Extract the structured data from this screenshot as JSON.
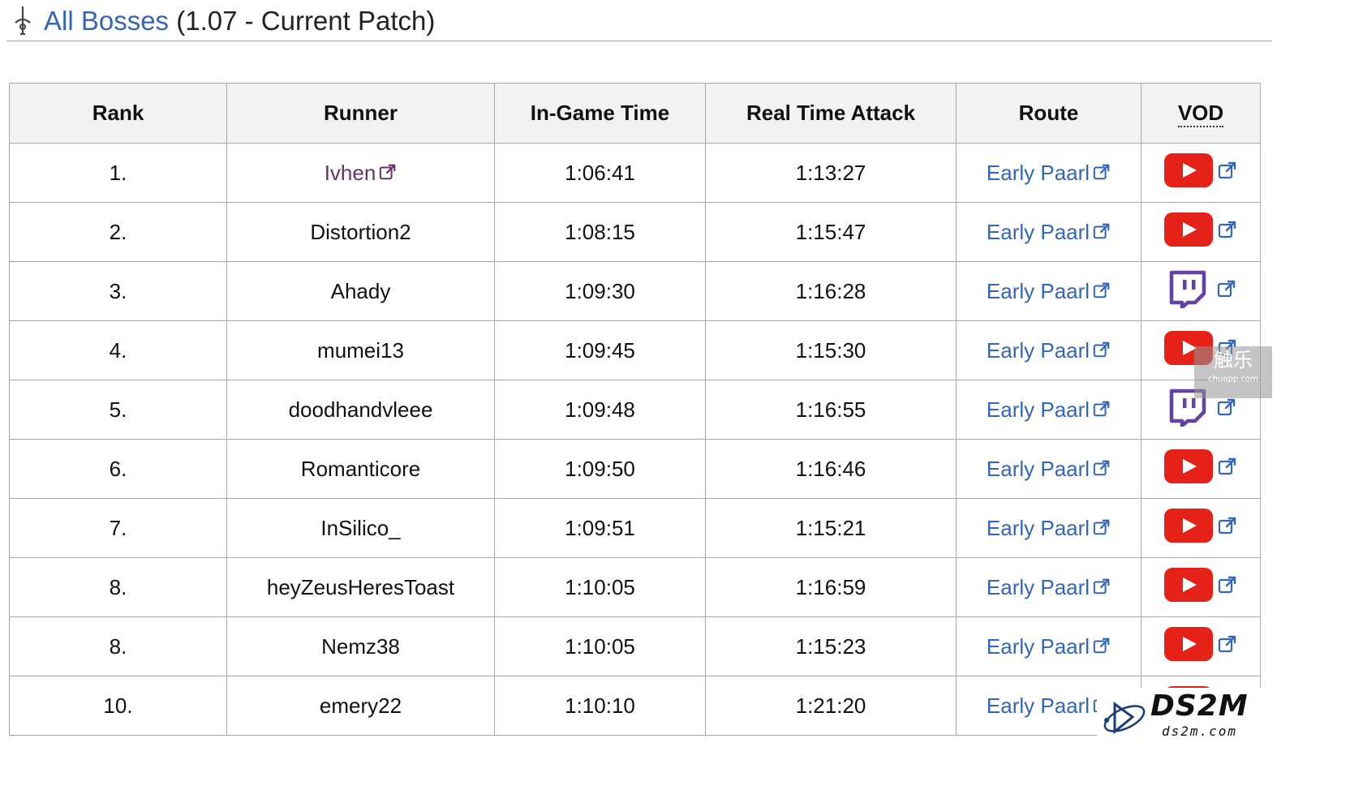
{
  "header": {
    "title_link": "All Bosses",
    "title_rest": " (1.07 - Current Patch)",
    "icon": "sword-icon"
  },
  "table": {
    "columns": [
      "Rank",
      "Runner",
      "In-Game Time",
      "Real Time Attack",
      "Route",
      "VOD"
    ],
    "rows": [
      {
        "rank": "1.",
        "runner": "Ivhen",
        "runner_link": true,
        "igt": "1:06:41",
        "rta": "1:13:27",
        "route": "Early Paarl",
        "vod": "youtube"
      },
      {
        "rank": "2.",
        "runner": "Distortion2",
        "runner_link": false,
        "igt": "1:08:15",
        "rta": "1:15:47",
        "route": "Early Paarl",
        "vod": "youtube"
      },
      {
        "rank": "3.",
        "runner": "Ahady",
        "runner_link": false,
        "igt": "1:09:30",
        "rta": "1:16:28",
        "route": "Early Paarl",
        "vod": "twitch"
      },
      {
        "rank": "4.",
        "runner": "mumei13",
        "runner_link": false,
        "igt": "1:09:45",
        "rta": "1:15:30",
        "route": "Early Paarl",
        "vod": "youtube"
      },
      {
        "rank": "5.",
        "runner": "doodhandvleee",
        "runner_link": false,
        "igt": "1:09:48",
        "rta": "1:16:55",
        "route": "Early Paarl",
        "vod": "twitch"
      },
      {
        "rank": "6.",
        "runner": "Romanticore",
        "runner_link": false,
        "igt": "1:09:50",
        "rta": "1:16:46",
        "route": "Early Paarl",
        "vod": "youtube"
      },
      {
        "rank": "7.",
        "runner": "InSilico_",
        "runner_link": false,
        "igt": "1:09:51",
        "rta": "1:15:21",
        "route": "Early Paarl",
        "vod": "youtube"
      },
      {
        "rank": "8.",
        "runner": "heyZeusHeresToast",
        "runner_link": false,
        "igt": "1:10:05",
        "rta": "1:16:59",
        "route": "Early Paarl",
        "vod": "youtube"
      },
      {
        "rank": "8.",
        "runner": "Nemz38",
        "runner_link": false,
        "igt": "1:10:05",
        "rta": "1:15:23",
        "route": "Early Paarl",
        "vod": "youtube"
      },
      {
        "rank": "10.",
        "runner": "emery22",
        "runner_link": false,
        "igt": "1:10:10",
        "rta": "1:21:20",
        "route": "Early Paarl",
        "vod": "youtube"
      }
    ]
  },
  "watermarks": {
    "chuapp_main": "触乐",
    "chuapp_sub": "chuapp.com",
    "ds2m_main": "DS2M",
    "ds2m_sub": "ds2m.com"
  },
  "colors": {
    "link_blue": "#3366bb",
    "visited_purple": "#663366",
    "youtube_red": "#e62117",
    "twitch_purple": "#6441a5",
    "border": "#a8a8a8",
    "header_bg": "#f2f2f2"
  }
}
